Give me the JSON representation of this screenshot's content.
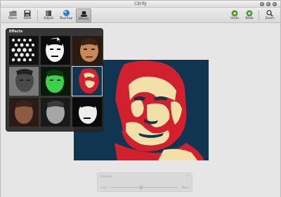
{
  "window": {
    "title": "Citrify"
  },
  "toolbar": {
    "open_label": "Open",
    "save_label": "Save",
    "adjust_label": "Adjust",
    "touchup_label": "Touchup",
    "effects_label": "Effects",
    "undo_label": "Undo",
    "redo_label": "Redo",
    "zoom_label": "Zoom",
    "active_tool": "Effects"
  },
  "effects_panel": {
    "title": "Effects",
    "thumbnails": [
      {
        "name": "thumb-polkadot",
        "style": "dots"
      },
      {
        "name": "thumb-highcontrast",
        "style": "contrast"
      },
      {
        "name": "thumb-warm",
        "style": "warm"
      },
      {
        "name": "thumb-grayscale-pencil",
        "style": "gray"
      },
      {
        "name": "thumb-green",
        "style": "green"
      },
      {
        "name": "thumb-dark",
        "style": "dark"
      },
      {
        "name": "thumb-poster",
        "style": "poster"
      },
      {
        "name": "thumb-sepia",
        "style": "sepia"
      },
      {
        "name": "thumb-bw",
        "style": "bw"
      }
    ],
    "selected_index": 6
  },
  "adjust_panel": {
    "title": "Intensity",
    "low_label": "Less",
    "high_label": "More",
    "close_label": "×"
  },
  "colors": {
    "poster_navy": "#0f3550",
    "poster_red": "#d2202f",
    "poster_cream": "#f3dfa8"
  },
  "icons": [
    "folder-icon",
    "floppy-disk-icon",
    "adjust-icon",
    "touchup-icon",
    "effects-hat-icon",
    "undo-icon",
    "redo-icon",
    "zoom-icon",
    "gear-icon"
  ]
}
